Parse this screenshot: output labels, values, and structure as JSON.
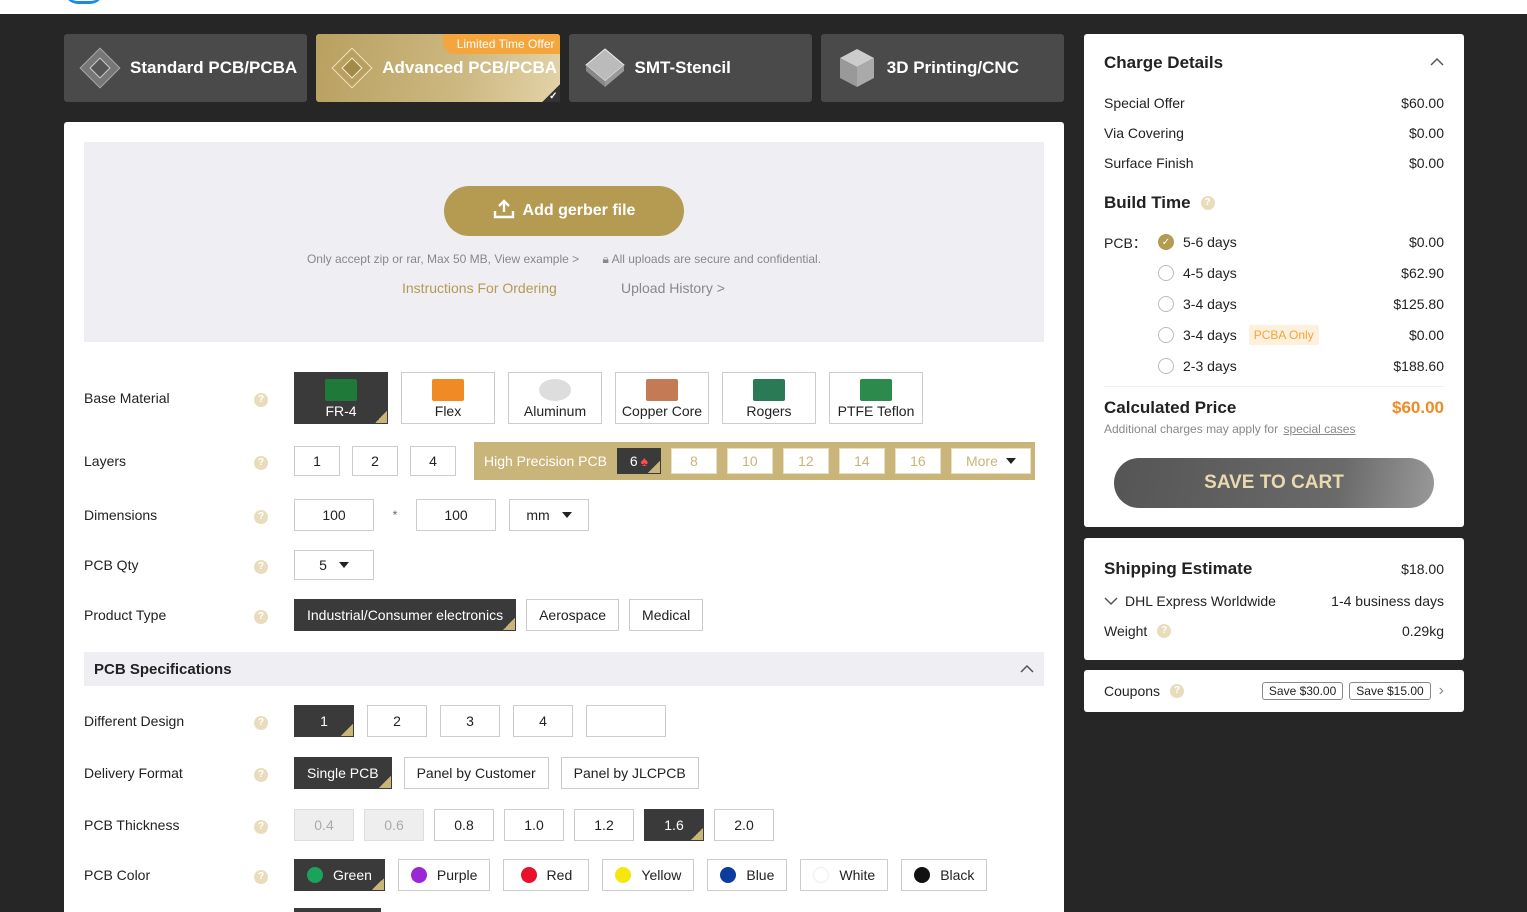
{
  "tabs": [
    {
      "label": "Standard PCB/PCBA",
      "icon": "pcb-chip-icon"
    },
    {
      "label": "Advanced PCB/PCBA",
      "icon": "pcb-chip-icon",
      "badge": "Limited Time Offer"
    },
    {
      "label": "SMT-Stencil",
      "icon": "stencil-icon"
    },
    {
      "label": "3D Printing/CNC",
      "icon": "cube-3d-icon"
    }
  ],
  "upload": {
    "button": "Add gerber file",
    "note": "Only accept zip or rar, Max 50 MB, View example >",
    "secure": "All uploads are secure and confidential.",
    "instructions": "Instructions For Ordering",
    "history": "Upload History >"
  },
  "form": {
    "base_material": {
      "label": "Base Material",
      "options": [
        "FR-4",
        "Flex",
        "Aluminum",
        "Copper Core",
        "Rogers",
        "PTFE Teflon"
      ],
      "selected": "FR-4"
    },
    "layers": {
      "label": "Layers",
      "options": [
        "1",
        "2",
        "4"
      ],
      "hp_label": "High Precision PCB",
      "hp_options": [
        "6",
        "8",
        "10",
        "12",
        "14",
        "16"
      ],
      "selected": "6",
      "more": "More"
    },
    "dimensions": {
      "label": "Dimensions",
      "width": "100",
      "sep": "*",
      "height": "100",
      "unit": "mm"
    },
    "qty": {
      "label": "PCB Qty",
      "value": "5"
    },
    "product_type": {
      "label": "Product Type",
      "options": [
        "Industrial/Consumer electronics",
        "Aerospace",
        "Medical"
      ],
      "selected": "Industrial/Consumer electronics"
    },
    "spec_title": "PCB Specifications",
    "different_design": {
      "label": "Different Design",
      "options": [
        "1",
        "2",
        "3",
        "4"
      ],
      "selected": "1"
    },
    "delivery_format": {
      "label": "Delivery Format",
      "options": [
        "Single PCB",
        "Panel by Customer",
        "Panel by JLCPCB"
      ],
      "selected": "Single PCB"
    },
    "thickness": {
      "label": "PCB Thickness",
      "options": [
        "0.4",
        "0.6",
        "0.8",
        "1.0",
        "1.2",
        "1.6",
        "2.0"
      ],
      "selected": "1.6",
      "disabled": [
        "0.4",
        "0.6"
      ]
    },
    "color": {
      "label": "PCB Color",
      "options": [
        {
          "name": "Green",
          "hex": "#1aa35a"
        },
        {
          "name": "Purple",
          "hex": "#9b27d6"
        },
        {
          "name": "Red",
          "hex": "#e8102a"
        },
        {
          "name": "Yellow",
          "hex": "#f5e60f"
        },
        {
          "name": "Blue",
          "hex": "#0c3d9c"
        },
        {
          "name": "White",
          "hex": "#ffffff"
        },
        {
          "name": "Black",
          "hex": "#111111"
        }
      ],
      "selected": "Green"
    }
  },
  "charge": {
    "title": "Charge Details",
    "lines": [
      {
        "label": "Special Offer",
        "value": "$60.00"
      },
      {
        "label": "Via Covering",
        "value": "$0.00"
      },
      {
        "label": "Surface Finish",
        "value": "$0.00"
      }
    ],
    "build_time_title": "Build Time",
    "pcb_label": "PCB：",
    "build_options": [
      {
        "days": "5-6 days",
        "price": "$0.00",
        "selected": true
      },
      {
        "days": "4-5 days",
        "price": "$62.90"
      },
      {
        "days": "3-4 days",
        "price": "$125.80"
      },
      {
        "days": "3-4 days",
        "price": "$0.00",
        "tag": "PCBA Only"
      },
      {
        "days": "2-3 days",
        "price": "$188.60"
      }
    ],
    "calc_label": "Calculated Price",
    "calc_value": "$60.00",
    "calc_note": "Additional charges may apply for",
    "calc_link": "special cases",
    "save_button": "SAVE TO CART"
  },
  "shipping": {
    "title": "Shipping Estimate",
    "price": "$18.00",
    "method": "DHL Express Worldwide",
    "eta": "1-4 business days",
    "weight_label": "Weight",
    "weight": "0.29kg"
  },
  "coupons": {
    "label": "Coupons",
    "tags": [
      "Save $30.00",
      "Save $15.00"
    ]
  },
  "colors": {
    "gold": "#b59a52",
    "accent_orange": "#f08a24",
    "dark": "#3a3a3a"
  }
}
